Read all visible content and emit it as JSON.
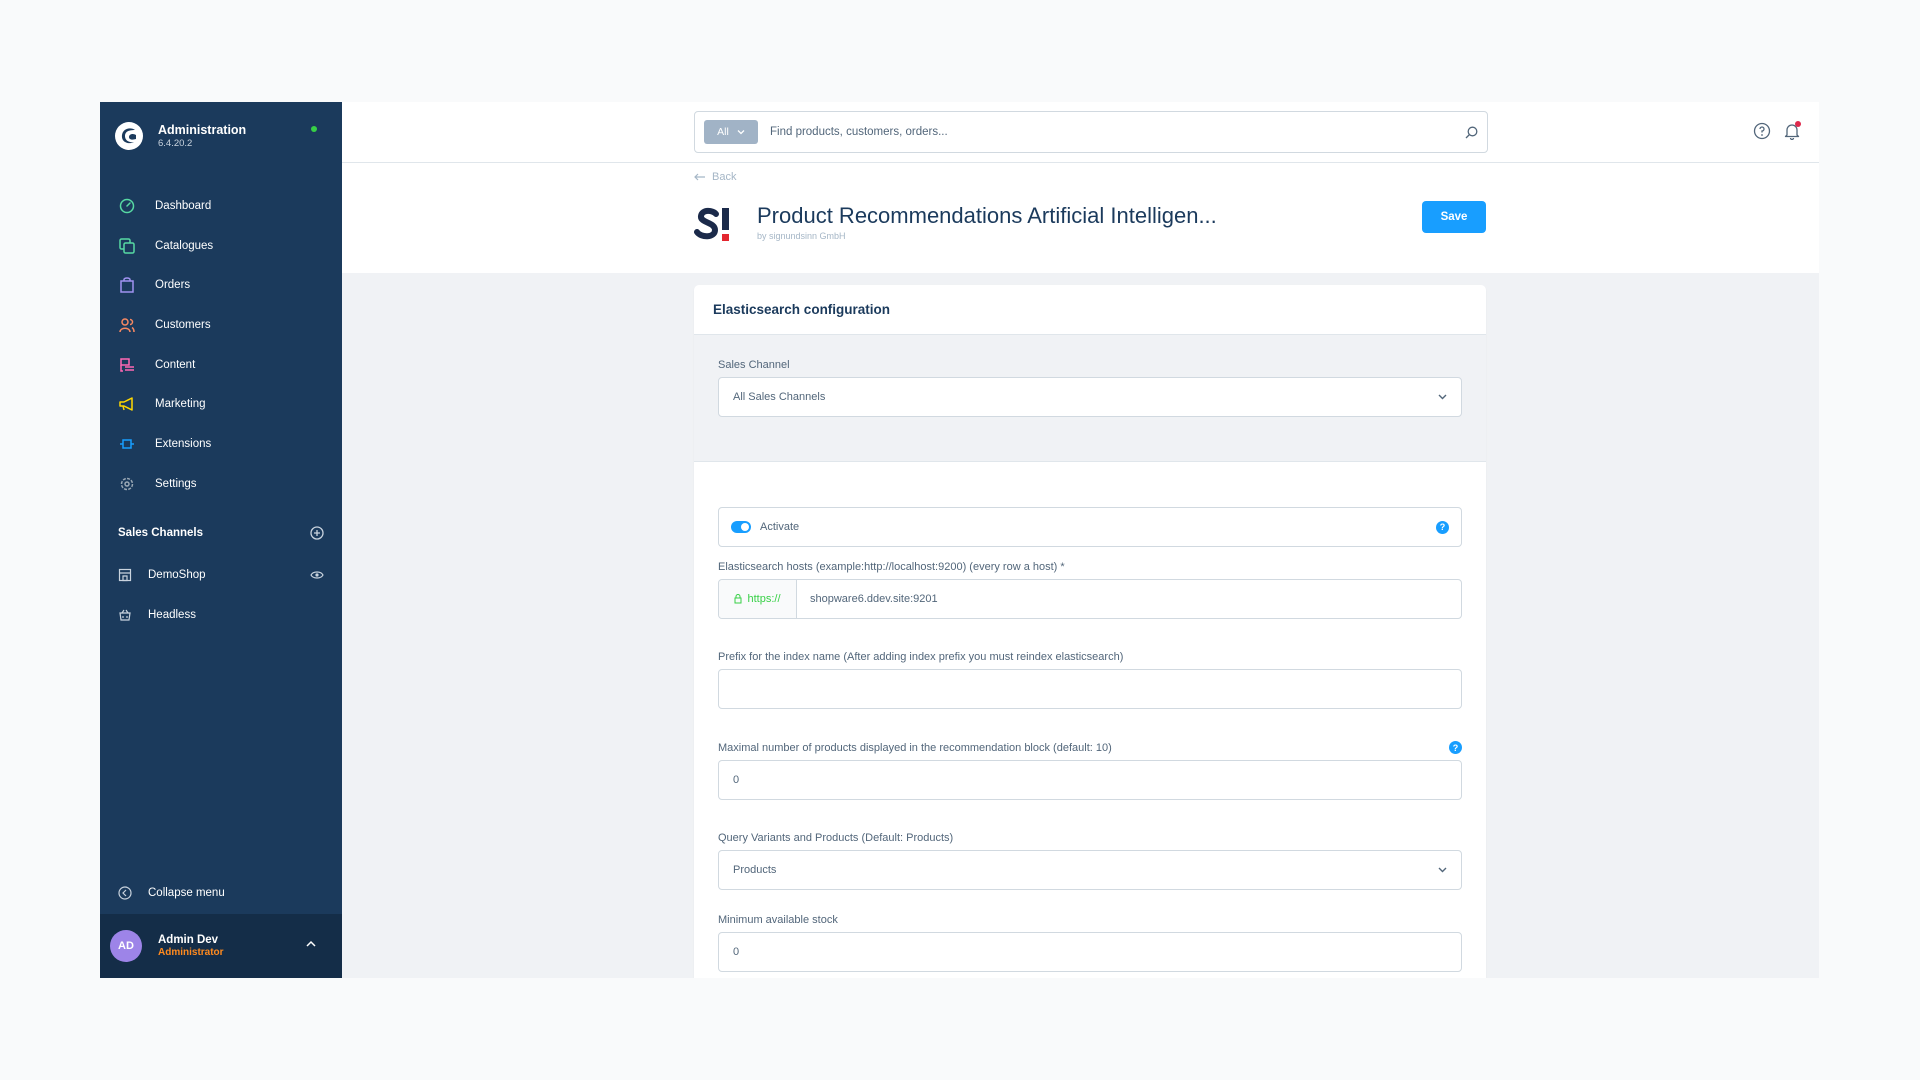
{
  "colors": {
    "sidebar_bg": "#1b3a5c",
    "accent": "#189eff",
    "status_online": "#37d046",
    "role_color": "#ff8a1f",
    "avatar_bg": "#9d84e8"
  },
  "sidebar": {
    "app_title": "Administration",
    "version": "6.4.20.2",
    "items": [
      {
        "label": "Dashboard",
        "icon": "dashboard-icon",
        "color": "#57d9a3"
      },
      {
        "label": "Catalogues",
        "icon": "catalogues-icon",
        "color": "#57d9a3"
      },
      {
        "label": "Orders",
        "icon": "orders-icon",
        "color": "#a092f0"
      },
      {
        "label": "Customers",
        "icon": "customers-icon",
        "color": "#f88962"
      },
      {
        "label": "Content",
        "icon": "content-icon",
        "color": "#ff68b4"
      },
      {
        "label": "Marketing",
        "icon": "marketing-icon",
        "color": "#ffd700"
      },
      {
        "label": "Extensions",
        "icon": "extensions-icon",
        "color": "#189eff"
      },
      {
        "label": "Settings",
        "icon": "settings-icon",
        "color": "#9aa8b5"
      }
    ],
    "sales_channels_title": "Sales Channels",
    "sales_channels": [
      {
        "label": "DemoShop",
        "icon": "storefront-icon"
      },
      {
        "label": "Headless",
        "icon": "headless-icon"
      }
    ],
    "collapse_label": "Collapse menu",
    "user": {
      "initials": "AD",
      "name": "Admin Dev",
      "role": "Administrator"
    }
  },
  "topbar": {
    "search_type": "All",
    "search_placeholder": "Find products, customers, orders..."
  },
  "header": {
    "back_label": "Back",
    "title": "Product Recommendations Artificial Intelligen...",
    "author": "by signundsinn GmbH",
    "save_label": "Save"
  },
  "card": {
    "title": "Elasticsearch configuration",
    "sales_channel_label": "Sales Channel",
    "sales_channel_value": "All Sales Channels",
    "activate_label": "Activate",
    "hosts_label": "Elasticsearch hosts (example:http://localhost:9200) (every row a host) *",
    "hosts_prefix": "https://",
    "hosts_value": "shopware6.ddev.site:9201",
    "prefix_label": "Prefix for the index name (After adding index prefix you must reindex elasticsearch)",
    "prefix_value": "",
    "max_products_label": "Maximal number of products displayed in the recommendation block (default: 10)",
    "max_products_value": "0",
    "query_label": "Query Variants and Products (Default: Products)",
    "query_value": "Products",
    "min_stock_label": "Minimum available stock",
    "min_stock_value": "0"
  }
}
